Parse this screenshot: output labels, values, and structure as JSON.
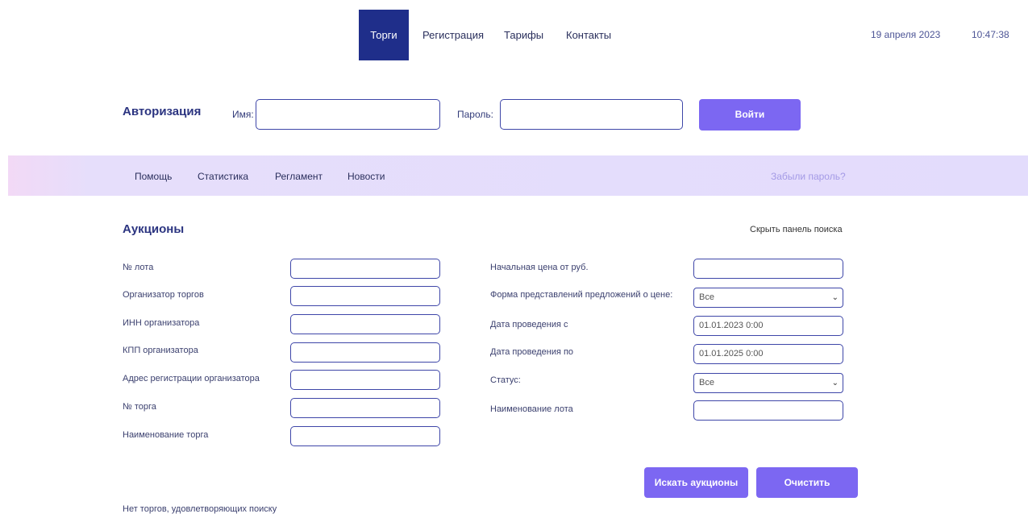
{
  "nav": {
    "items": [
      {
        "label": "Торги"
      },
      {
        "label": "Регистрация"
      },
      {
        "label": "Тарифы"
      },
      {
        "label": "Контакты"
      }
    ],
    "date": "19 апреля 2023",
    "time": "10:47:38"
  },
  "auth": {
    "title": "Авторизация",
    "name_label": "Имя:",
    "name_value": "",
    "password_label": "Пароль:",
    "password_value": "",
    "login_button": "Войти"
  },
  "band": {
    "items": [
      {
        "label": "Помощь"
      },
      {
        "label": "Статистика"
      },
      {
        "label": "Регламент"
      },
      {
        "label": "Новости"
      }
    ],
    "forgot": "Забыли пароль?"
  },
  "auctions": {
    "title": "Аукционы",
    "hide_panel": "Скрыть панель поиска",
    "left_fields": [
      {
        "label": "№ лота",
        "value": ""
      },
      {
        "label": "Организатор торгов",
        "value": ""
      },
      {
        "label": "ИНН организатора",
        "value": ""
      },
      {
        "label": "КПП организатора",
        "value": ""
      },
      {
        "label": "Адрес регистрации организатора",
        "value": ""
      },
      {
        "label": "№ торга",
        "value": ""
      },
      {
        "label": "Наименование торга",
        "value": ""
      }
    ],
    "right_fields": [
      {
        "label": "Начальная цена от руб.",
        "value": ""
      },
      {
        "label": "Форма представлений предложений о цене:",
        "value": "Все"
      },
      {
        "label": "Дата проведения с",
        "value": "01.01.2023 0:00"
      },
      {
        "label": "Дата проведения по",
        "value": "01.01.2025 0:00"
      },
      {
        "label": "Статус:",
        "value": "Все"
      },
      {
        "label": "Наименование лота",
        "value": ""
      }
    ],
    "search_button": "Искать аукционы",
    "clear_button": "Очистить",
    "result_text": "Нет торгов, удовлетворяющих поиску"
  },
  "colors": {
    "accent": "#7c67f2",
    "nav_active": "#1f2e8a",
    "band": "#e3dcfc"
  }
}
